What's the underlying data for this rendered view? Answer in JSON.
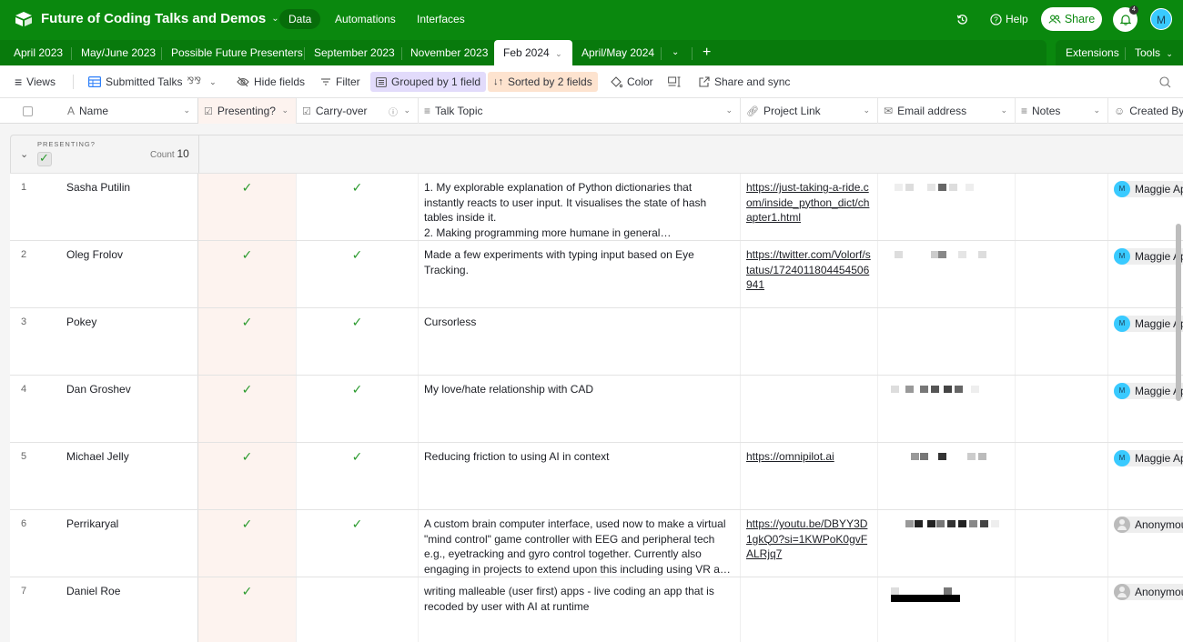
{
  "app": {
    "base_title": "Future of Coding Talks and Demos",
    "nav": [
      {
        "label": "Data",
        "active": true
      },
      {
        "label": "Automations",
        "active": false
      },
      {
        "label": "Interfaces",
        "active": false
      }
    ],
    "help_label": "Help",
    "share_label": "Share",
    "notification_count": "4",
    "user_initial": "M",
    "brand_color": "#0a880e"
  },
  "tables": {
    "tabs": [
      {
        "label": "April 2023"
      },
      {
        "label": "May/June 2023"
      },
      {
        "label": "Possible Future Presenters"
      },
      {
        "label": "September 2023"
      },
      {
        "label": "November 2023"
      },
      {
        "label": "Feb 2024",
        "active": true
      },
      {
        "label": "April/May 2024"
      }
    ],
    "extensions_label": "Extensions",
    "tools_label": "Tools"
  },
  "toolbar": {
    "views_label": "Views",
    "view_name": "Submitted Talks",
    "hide_fields_label": "Hide fields",
    "filter_label": "Filter",
    "grouped_label": "Grouped by 1 field",
    "sorted_label": "Sorted by 2 fields",
    "color_label": "Color",
    "share_sync_label": "Share and sync"
  },
  "columns": [
    {
      "label": "Name",
      "icon": "text-icon"
    },
    {
      "label": "Presenting?",
      "icon": "checkbox-icon"
    },
    {
      "label": "Carry-over",
      "icon": "checkbox-icon"
    },
    {
      "label": "Talk Topic",
      "icon": "long-text-icon"
    },
    {
      "label": "Project Link",
      "icon": "link-icon"
    },
    {
      "label": "Email address",
      "icon": "email-icon"
    },
    {
      "label": "Notes",
      "icon": "long-text-icon"
    },
    {
      "label": "Created By",
      "icon": "user-icon"
    }
  ],
  "group": {
    "field_label": "PRESENTING?",
    "value": "checked",
    "count_label": "Count",
    "count": "10"
  },
  "rows": [
    {
      "num": "1",
      "name": "Sasha Putilin",
      "presenting": true,
      "carry_over": true,
      "topic": "1. My explorable explanation of Python dictionaries that instantly reacts to user input. It visualises the state of hash tables inside it.\n2. Making programming more humane in general\n...",
      "link": "https://just-taking-a-ride.com/inside_python_dict/chapter1.html",
      "email": "[redacted]",
      "notes": "",
      "created_by": "Maggie Ap",
      "created_by_type": "user"
    },
    {
      "num": "2",
      "name": "Oleg Frolov",
      "presenting": true,
      "carry_over": true,
      "topic": "Made a few experiments with typing input based on Eye Tracking.",
      "link": "https://twitter.com/Volorf/status/1724011804454506941",
      "email": "[redacted]",
      "notes": "",
      "created_by": "Maggie Ap",
      "created_by_type": "user"
    },
    {
      "num": "3",
      "name": "Pokey",
      "presenting": true,
      "carry_over": true,
      "topic": "Cursorless",
      "link": "",
      "email": "",
      "notes": "",
      "created_by": "Maggie Ap",
      "created_by_type": "user"
    },
    {
      "num": "4",
      "name": "Dan Groshev",
      "presenting": true,
      "carry_over": true,
      "topic": "My love/hate relationship with CAD",
      "link": "",
      "email": "[redacted]",
      "notes": "",
      "created_by": "Maggie Ap",
      "created_by_type": "user"
    },
    {
      "num": "5",
      "name": "Michael Jelly",
      "presenting": true,
      "carry_over": true,
      "topic": "Reducing friction to using AI in context",
      "link": "https://omnipilot.ai",
      "email": "[redacted]",
      "notes": "",
      "created_by": "Maggie Ap",
      "created_by_type": "user"
    },
    {
      "num": "6",
      "name": "Perrikaryal",
      "presenting": true,
      "carry_over": true,
      "topic": "A custom brain computer interface, used now to make a virtual \"mind control\" game controller with EEG and peripheral tech e.g., eyetracking and gyro control together. Currently also engaging in projects to extend upon this including using VR and tech such as ...",
      "link": "https://youtu.be/DBYY3D1gkQ0?si=1KWPoK0gvFALRjq7",
      "email": "[redacted]",
      "notes": "",
      "created_by": "Anonymous",
      "created_by_type": "anonymous"
    },
    {
      "num": "7",
      "name": "Daniel Roe",
      "presenting": true,
      "carry_over": false,
      "topic": "writing malleable (user first) apps - live coding an app that is recoded by user with AI at runtime",
      "link": "",
      "email": "[redacted]",
      "notes": "",
      "created_by": "Anonymous",
      "created_by_type": "anonymous"
    }
  ]
}
